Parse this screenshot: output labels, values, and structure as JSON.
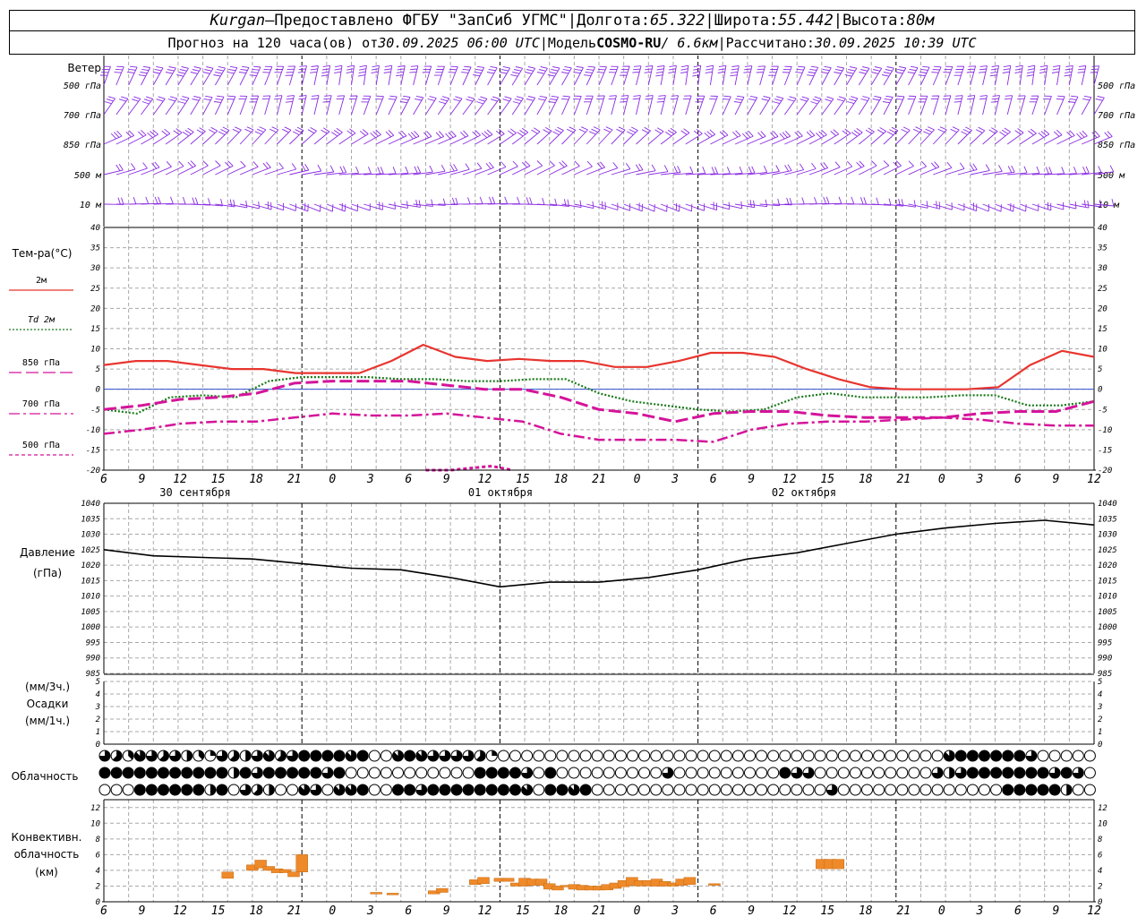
{
  "header": {
    "station": "Kurgan",
    "dash": " — ",
    "provider": "Предоставлено ФГБУ \"ЗапСиб УГМС\"",
    "lon_label": "Долгота: ",
    "lon": "65.322",
    "lat_label": "Широта: ",
    "lat": "55.442",
    "alt_label": "Высота: ",
    "alt": "80м",
    "forecast_label": "Прогноз на 120 часа(ов) от ",
    "forecast_start": "30.09.2025 06:00 UTC",
    "model_label": "Модель ",
    "model": "COSMO-RU",
    "model_res": "/ 6.6км",
    "calc_label": "Рассчитано: ",
    "calc_time": "30.09.2025 10:39 UTC",
    "sep": " | "
  },
  "x_axis": {
    "hour_labels": [
      "6",
      "9",
      "12",
      "15",
      "18",
      "21",
      "0",
      "3",
      "6",
      "9",
      "12",
      "15",
      "18",
      "21",
      "0",
      "3",
      "6",
      "9",
      "12",
      "15",
      "18",
      "21",
      "0",
      "3",
      "6",
      "9",
      "12"
    ],
    "dates": [
      "30 сентября",
      "01 октября",
      "02 октября"
    ]
  },
  "wind": {
    "title": "Ветер",
    "levels": [
      "500 гПа",
      "700 гПа",
      "850 гПа",
      "500 м",
      "10  м"
    ]
  },
  "temperature": {
    "title": "Тем-ра(°С)",
    "legend": [
      {
        "label": "2м",
        "color": "#e8352f",
        "style": "solid"
      },
      {
        "label": "Td  2м",
        "color": "#1a7a1a",
        "style": "dotted"
      },
      {
        "label": "850 гПа",
        "color": "#d4149a",
        "style": "solid"
      },
      {
        "label": "700 гПа",
        "color": "#d4149a",
        "style": "dashdot"
      },
      {
        "label": "500 гПа",
        "color": "#d4149a",
        "style": "dashed"
      }
    ]
  },
  "pressure": {
    "title": "Давление",
    "unit": "(гПа)"
  },
  "precip": {
    "unit3": "(мм/3ч.)",
    "title": "Осадки",
    "unit1": "(мм/1ч.)"
  },
  "clouds": {
    "title": "Облачность"
  },
  "convective": {
    "title1": "Конвективн.",
    "title2": "облачность",
    "unit": "(км)"
  },
  "chart_data": [
    {
      "type": "line",
      "name": "temperature",
      "x": [
        -6,
        -3,
        0,
        3,
        6,
        9,
        12,
        15,
        18,
        21,
        24,
        27,
        30,
        33,
        36,
        39,
        42,
        45,
        48,
        51,
        54,
        57,
        60,
        63,
        66,
        69,
        72,
        75,
        78,
        81,
        84,
        87,
        90,
        93,
        96,
        99,
        102,
        105,
        108,
        111,
        114
      ],
      "ylim": [
        -20,
        40
      ],
      "yticks": [
        -20,
        -15,
        -10,
        -5,
        0,
        5,
        10,
        15,
        20,
        25,
        30,
        35,
        40
      ],
      "series": [
        {
          "name": "2м",
          "color": "#e8352f",
          "values": [
            6,
            7,
            7,
            6,
            5,
            5,
            4,
            4,
            4,
            7,
            11,
            8,
            7,
            7.5,
            7,
            7,
            5.5,
            5.5,
            7,
            9,
            9,
            8,
            5,
            2.5,
            0.5,
            0,
            0,
            0,
            0.5,
            6,
            9.5,
            8
          ]
        },
        {
          "name": "Td  2м",
          "color": "#1a7a1a",
          "values": [
            -5,
            -6,
            -2,
            -1.5,
            -2,
            2,
            3,
            3,
            3,
            2.5,
            2.5,
            2,
            2,
            2.5,
            2.5,
            -1,
            -3,
            -4,
            -5,
            -5.5,
            -5,
            -2,
            -1,
            -2,
            -2,
            -2,
            -1.5,
            -1.5,
            -4,
            -4,
            -3
          ]
        },
        {
          "name": "850 гПа",
          "color": "#d4149a",
          "values": [
            -5,
            -4,
            -2.5,
            -2,
            -1,
            1.5,
            2,
            2,
            2,
            1,
            0,
            0,
            -2,
            -5,
            -6,
            -8,
            -6,
            -5.5,
            -5.5,
            -6.5,
            -7,
            -7,
            -7,
            -6,
            -5.5,
            -5.5,
            -3
          ]
        },
        {
          "name": "700 гПа",
          "color": "#d4149a",
          "values": [
            -11,
            -10,
            -8.5,
            -8,
            -8,
            -7,
            -6,
            -6.5,
            -6.5,
            -6,
            -7,
            -8,
            -11,
            -12.5,
            -12.5,
            -12.5,
            -13,
            -10,
            -8.5,
            -8,
            -8,
            -7.5,
            -7,
            -7.5,
            -8.5,
            -9,
            -9
          ]
        },
        {
          "name": "500 гПа",
          "color": "#d4149a",
          "values": [
            -20,
            -19.5,
            -19,
            -20
          ]
        }
      ]
    },
    {
      "type": "line",
      "name": "pressure",
      "x": [
        -6,
        0,
        6,
        12,
        18,
        24,
        30,
        36,
        42,
        48,
        54,
        60,
        66,
        72,
        78,
        84,
        90,
        96,
        102,
        108,
        114
      ],
      "ylim": [
        985,
        1040
      ],
      "yticks": [
        985,
        990,
        995,
        1000,
        1005,
        1010,
        1015,
        1020,
        1025,
        1030,
        1035,
        1040
      ],
      "series": [
        {
          "name": "",
          "color": "#000000",
          "values": [
            1025,
            1023,
            1022.5,
            1022,
            1020.5,
            1019,
            1018.5,
            1016,
            1013,
            1014.5,
            1014.5,
            1016,
            1018.5,
            1022,
            1024,
            1027,
            1030,
            1032,
            1033.5,
            1034.5,
            1033
          ]
        }
      ]
    },
    {
      "type": "bar",
      "name": "precipitation",
      "ylim": [
        0,
        5
      ],
      "yticks": [
        0,
        1,
        2,
        3,
        4,
        5
      ],
      "values": []
    },
    {
      "type": "bar",
      "name": "convective_cloud",
      "ylim": [
        0,
        13
      ],
      "yticks": [
        0,
        2,
        4,
        6,
        8,
        10,
        12
      ],
      "bars": [
        {
          "x": 9,
          "bottom": 3,
          "top": 3.8
        },
        {
          "x": 12,
          "bottom": 4,
          "top": 4.7
        },
        {
          "x": 13,
          "bottom": 4.3,
          "top": 5.3
        },
        {
          "x": 14,
          "bottom": 4,
          "top": 4.5
        },
        {
          "x": 15,
          "bottom": 3.7,
          "top": 4.2
        },
        {
          "x": 16,
          "bottom": 3.7,
          "top": 4.1
        },
        {
          "x": 17,
          "bottom": 3.2,
          "top": 3.8
        },
        {
          "x": 18,
          "bottom": 3.8,
          "top": 6
        },
        {
          "x": 27,
          "bottom": 1,
          "top": 1.2
        },
        {
          "x": 29,
          "bottom": 0.9,
          "top": 1.1
        },
        {
          "x": 34,
          "bottom": 1,
          "top": 1.4
        },
        {
          "x": 35,
          "bottom": 1.2,
          "top": 1.7
        },
        {
          "x": 39,
          "bottom": 2.2,
          "top": 2.8
        },
        {
          "x": 40,
          "bottom": 2.3,
          "top": 3.1
        },
        {
          "x": 42,
          "bottom": 2.6,
          "top": 3
        },
        {
          "x": 43,
          "bottom": 2.6,
          "top": 3
        },
        {
          "x": 44,
          "bottom": 2,
          "top": 2.4
        },
        {
          "x": 45,
          "bottom": 2,
          "top": 3
        },
        {
          "x": 46,
          "bottom": 2.1,
          "top": 2.9
        },
        {
          "x": 47,
          "bottom": 2.1,
          "top": 2.9
        },
        {
          "x": 48,
          "bottom": 1.6,
          "top": 2.3
        },
        {
          "x": 49,
          "bottom": 1.5,
          "top": 2
        },
        {
          "x": 50,
          "bottom": 1.9,
          "top": 2.1
        },
        {
          "x": 51,
          "bottom": 1.6,
          "top": 2.2
        },
        {
          "x": 52,
          "bottom": 1.5,
          "top": 2.1
        },
        {
          "x": 53,
          "bottom": 1.5,
          "top": 2
        },
        {
          "x": 54,
          "bottom": 1.5,
          "top": 2
        },
        {
          "x": 55,
          "bottom": 1.5,
          "top": 2.2
        },
        {
          "x": 56,
          "bottom": 1.7,
          "top": 2.4
        },
        {
          "x": 57,
          "bottom": 1.9,
          "top": 2.7
        },
        {
          "x": 58,
          "bottom": 2.1,
          "top": 3.1
        },
        {
          "x": 59,
          "bottom": 2,
          "top": 2.7
        },
        {
          "x": 60,
          "bottom": 2,
          "top": 2.7
        },
        {
          "x": 61,
          "bottom": 2,
          "top": 2.9
        },
        {
          "x": 62,
          "bottom": 2,
          "top": 2.6
        },
        {
          "x": 63,
          "bottom": 2,
          "top": 2.4
        },
        {
          "x": 64,
          "bottom": 2.1,
          "top": 2.9
        },
        {
          "x": 65,
          "bottom": 2.2,
          "top": 3.1
        },
        {
          "x": 68,
          "bottom": 2.1,
          "top": 2.3
        },
        {
          "x": 81,
          "bottom": 4.2,
          "top": 5.4
        },
        {
          "x": 82,
          "bottom": 4.2,
          "top": 5.4
        },
        {
          "x": 83,
          "bottom": 4.2,
          "top": 5.4
        }
      ]
    }
  ],
  "cloud_cover": {
    "rows": [
      [
        6,
        5,
        3,
        7,
        6,
        5,
        6,
        4,
        3,
        2,
        6,
        5,
        4,
        6,
        7,
        5,
        6,
        8,
        8,
        8,
        8,
        7,
        8,
        0,
        0,
        7,
        8,
        7,
        6,
        6,
        6,
        6,
        5,
        2,
        0,
        0,
        0,
        0,
        0,
        0,
        0,
        0,
        0,
        0,
        0,
        0,
        0,
        0,
        0,
        0,
        0,
        0,
        0,
        0,
        0,
        0,
        0,
        0,
        0,
        0,
        0,
        0,
        0,
        0,
        0,
        0,
        0,
        0,
        0,
        0,
        0,
        0,
        7,
        8,
        8,
        8,
        8,
        8,
        8,
        6,
        0,
        0,
        0,
        0,
        0,
        0
      ],
      [
        8,
        8,
        8,
        8,
        8,
        8,
        8,
        8,
        8,
        8,
        8,
        4,
        8,
        6,
        8,
        8,
        8,
        8,
        8,
        6,
        8,
        0,
        0,
        0,
        0,
        0,
        0,
        0,
        0,
        0,
        0,
        0,
        8,
        8,
        8,
        8,
        6,
        0,
        8,
        0,
        0,
        0,
        0,
        0,
        0,
        0,
        0,
        0,
        6,
        0,
        0,
        0,
        0,
        0,
        0,
        0,
        0,
        0,
        8,
        6,
        6,
        0,
        0,
        0,
        0,
        0,
        0,
        0,
        0,
        0,
        0,
        6,
        4,
        6,
        8,
        8,
        8,
        8,
        8,
        8,
        8,
        6,
        8,
        6,
        0,
        0,
        0,
        0
      ],
      [
        0,
        0,
        0,
        8,
        8,
        8,
        8,
        8,
        8,
        4,
        8,
        0,
        6,
        5,
        4,
        0,
        0,
        7,
        6,
        0,
        7,
        7,
        8,
        0,
        0,
        8,
        8,
        6,
        8,
        8,
        8,
        8,
        8,
        8,
        8,
        8,
        7,
        0,
        8,
        8,
        7,
        8,
        0,
        0,
        0,
        0,
        0,
        0,
        0,
        0,
        0,
        0,
        0,
        0,
        0,
        0,
        0,
        0,
        0,
        0,
        0,
        0,
        6,
        0,
        0,
        0,
        0,
        0,
        0,
        0,
        0,
        0,
        0,
        0,
        0,
        0,
        0,
        8,
        8,
        8,
        8,
        8,
        4,
        0,
        0,
        0,
        0,
        0
      ]
    ]
  }
}
